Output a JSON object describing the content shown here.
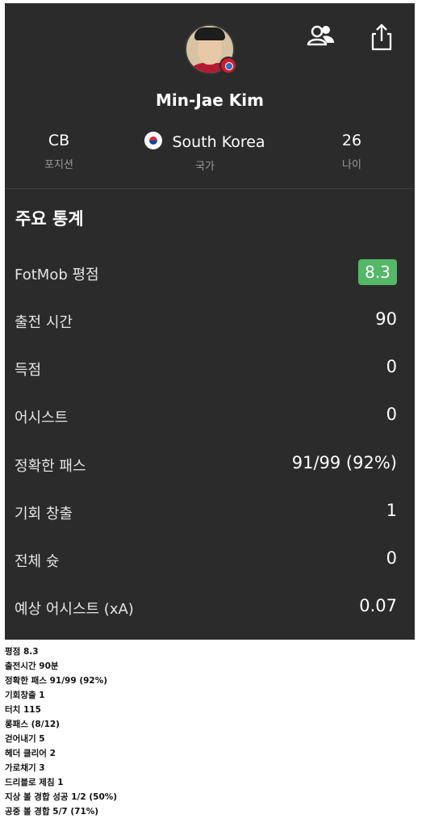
{
  "player": {
    "name": "Min-Jae Kim",
    "position_value": "CB",
    "position_label": "포지션",
    "country_value": "South Korea",
    "country_label": "국가",
    "age_value": "26",
    "age_label": "나이"
  },
  "stats": {
    "title": "주요 통계",
    "rows": [
      {
        "label": "FotMob 평점",
        "value": "8.3"
      },
      {
        "label": "출전 시간",
        "value": "90"
      },
      {
        "label": "득점",
        "value": "0"
      },
      {
        "label": "어시스트",
        "value": "0"
      },
      {
        "label": "정확한 패스",
        "value": "91/99 (92%)"
      },
      {
        "label": "기회 창출",
        "value": "1"
      },
      {
        "label": "전체 슛",
        "value": "0"
      },
      {
        "label": "예상 어시스트 (xA)",
        "value": "0.07"
      }
    ]
  },
  "notes": [
    "평점 8.3",
    "출전시간 90분",
    "정확한 패스 91/99 (92%)",
    "기회창출 1",
    "터치 115",
    "롱패스 (8/12)",
    "걷어내기 5",
    "헤더 클리어 2",
    "가로채기 3",
    "드리블로 제침 1",
    "지상 볼 경합 성공 1/2 (50%)",
    "공중 볼 경합 5/7 (71%)"
  ],
  "colors": {
    "card_bg": "#2b2b2b",
    "rating_badge": "#55b768"
  },
  "icons": {
    "follow": "person-add-icon",
    "share": "share-icon"
  }
}
